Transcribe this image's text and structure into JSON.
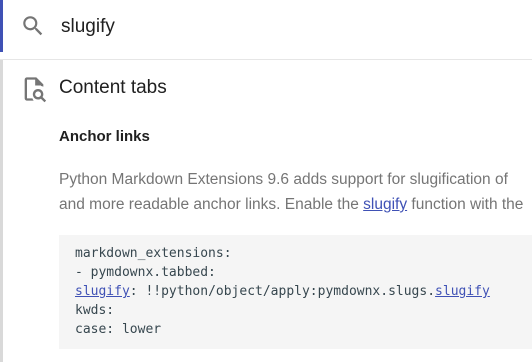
{
  "search": {
    "value": "slugify",
    "icon": "search-icon"
  },
  "result": {
    "icon": "document-search-icon",
    "title": "Content tabs",
    "subtitle": "Anchor links",
    "body_line1": "Python Markdown Extensions 9.6 adds support for slugification of",
    "body_line2_before": "and more readable anchor links. Enable the ",
    "body_line2_link": "slugify",
    "body_line2_after": " function with the",
    "code": {
      "line1": "markdown_extensions:",
      "line2": "- pymdownx.tabbed:",
      "line3_link": "slugify",
      "line3_mid": ": !!python/object/apply:pymdownx.slugs.",
      "line3_link2": "slugify",
      "line4": "kwds:",
      "line5": "case: lower"
    }
  },
  "colors": {
    "accent": "#3f51b5",
    "text": "#202020",
    "muted": "#757575",
    "code_bg": "#f5f5f5"
  }
}
